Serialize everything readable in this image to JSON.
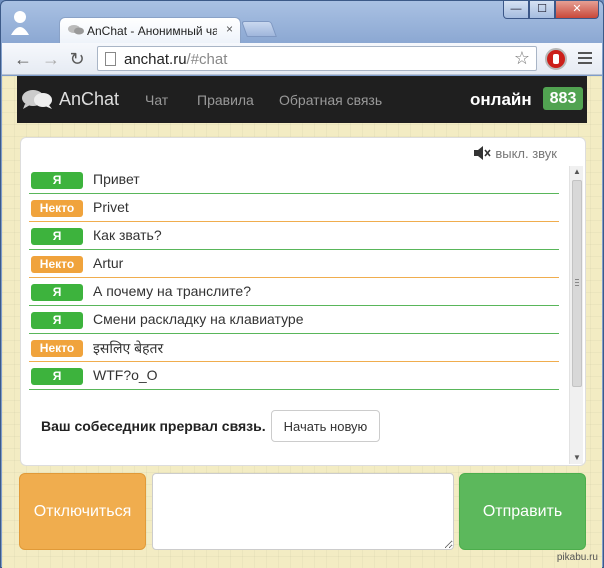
{
  "browser": {
    "tab_title": "AnChat - Анонимный ча",
    "tab_close": "×",
    "url_host": "anchat.ru",
    "url_path": "/#chat",
    "window_buttons": {
      "minimize": "—",
      "maximize": "☐",
      "close": "✕"
    }
  },
  "navbar": {
    "brand": "AnChat",
    "links": [
      "Чат",
      "Правила",
      "Обратная связь"
    ],
    "online_label": "онлайн",
    "online_count": "883"
  },
  "chat": {
    "sound_toggle": "выкл. звук",
    "messages": [
      {
        "sender": "Я",
        "text": "Привет"
      },
      {
        "sender": "Некто",
        "text": "Privet"
      },
      {
        "sender": "Я",
        "text": "Как звать?"
      },
      {
        "sender": "Некто",
        "text": "Artur"
      },
      {
        "sender": "Я",
        "text": "А почему на транслите?"
      },
      {
        "sender": "Я",
        "text": "Смени раскладку на клавиатуре"
      },
      {
        "sender": "Некто",
        "text": "इसलिए बेहतर"
      },
      {
        "sender": "Я",
        "text": "WTF?o_O"
      }
    ],
    "status_text": "Ваш собеседник прервал связь.",
    "restart_label": "Начать новую"
  },
  "controls": {
    "disconnect_label": "Отключиться",
    "message_value": "",
    "send_label": "Отправить"
  },
  "watermark": "pikabu.ru",
  "colors": {
    "me": "#3db33d",
    "other": "#f0a33c",
    "online_badge": "#51a351",
    "navbar": "#1f1f1f"
  }
}
